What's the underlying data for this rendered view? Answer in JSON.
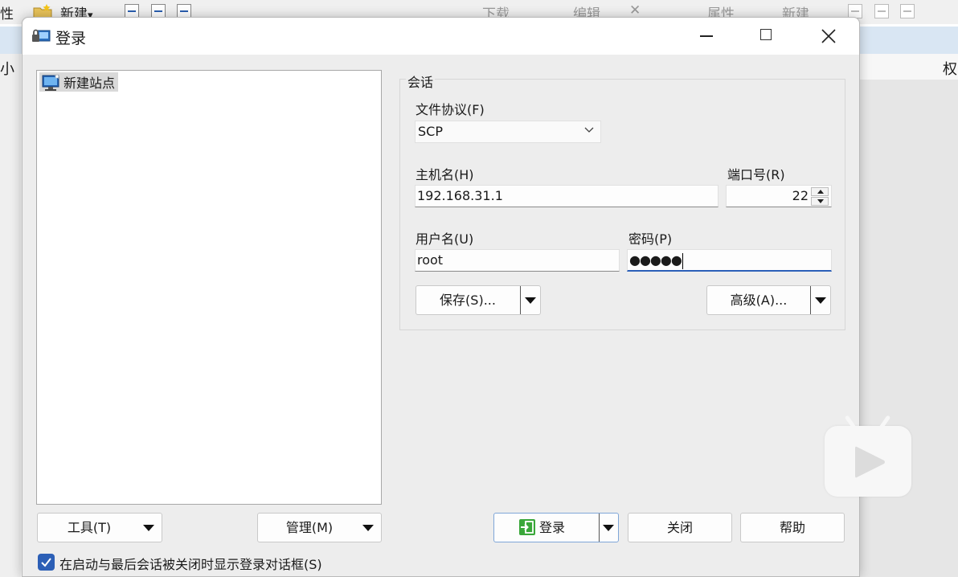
{
  "background": {
    "toolbar_left": {
      "partial_label": "性",
      "new_label": "新建",
      "new_arrow": "▾"
    },
    "toolbar_right": {
      "download_label": "下载",
      "edit_label": "编辑",
      "properties_label": "属性",
      "new_label": "新建"
    },
    "col_left_header": "小",
    "col_right_header": "权"
  },
  "dialog": {
    "title": "登录",
    "icon": "lock-computer-icon",
    "tree": {
      "items": [
        {
          "label": "新建站点",
          "icon": "monitor-icon",
          "selected": true
        }
      ]
    },
    "session": {
      "group_label": "会话",
      "protocol_label": "文件协议(F)",
      "protocol_value": "SCP",
      "host_label": "主机名(H)",
      "host_value": "192.168.31.1",
      "port_label": "端口号(R)",
      "port_value": "22",
      "user_label": "用户名(U)",
      "user_value": "root",
      "password_label": "密码(P)",
      "password_mask": "●●●●●",
      "save_button": "保存(S)...",
      "advanced_button": "高级(A)..."
    },
    "bottom": {
      "tools_button": "工具(T)",
      "manage_button": "管理(M)",
      "login_button": "登录",
      "close_button": "关闭",
      "help_button": "帮助",
      "startup_checkbox_label": "在启动与最后会话被关闭时显示登录对话框(S)",
      "startup_checkbox_checked": true
    }
  },
  "colors": {
    "accent": "#2c5fb6",
    "dialog_bg": "#ededed",
    "login_icon_green": "#3aa73a"
  }
}
